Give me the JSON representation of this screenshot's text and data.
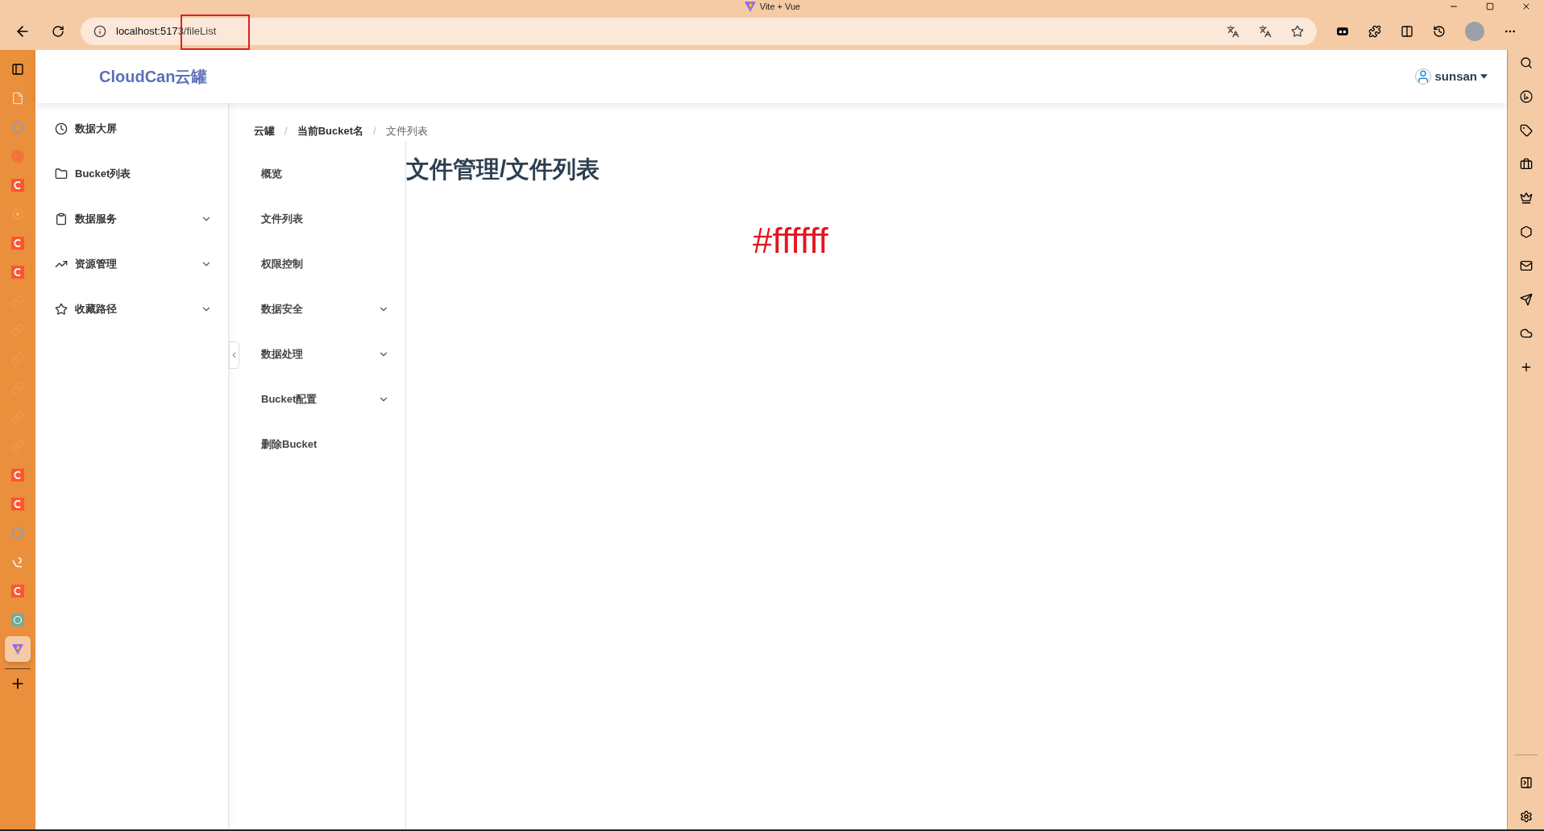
{
  "window": {
    "title": "Vite + Vue"
  },
  "address_bar": {
    "url_host": "localhost:517",
    "url_rest": "3/fileList"
  },
  "annotation": {
    "kind": "highlight"
  },
  "browser_tabs": [
    {
      "kind": "panel",
      "selected": false
    },
    {
      "kind": "page",
      "selected": false
    },
    {
      "kind": "blue",
      "selected": false
    },
    {
      "kind": "orange",
      "selected": false
    },
    {
      "kind": "c",
      "selected": false
    },
    {
      "kind": "flower",
      "selected": false
    },
    {
      "kind": "c",
      "selected": false
    },
    {
      "kind": "c",
      "selected": false
    },
    {
      "kind": "link",
      "selected": false
    },
    {
      "kind": "link",
      "selected": false
    },
    {
      "kind": "link",
      "selected": false
    },
    {
      "kind": "link",
      "selected": false
    },
    {
      "kind": "link",
      "selected": false
    },
    {
      "kind": "link",
      "selected": false
    },
    {
      "kind": "c",
      "selected": false
    },
    {
      "kind": "c",
      "selected": false
    },
    {
      "kind": "blue",
      "selected": false
    },
    {
      "kind": "swirl",
      "selected": false
    },
    {
      "kind": "c",
      "selected": false
    },
    {
      "kind": "ai",
      "selected": false
    },
    {
      "kind": "vite",
      "selected": true
    }
  ],
  "app": {
    "logo": "CloudCan云罐",
    "user": "sunsan"
  },
  "sidebar": {
    "items": [
      {
        "label": "数据大屏",
        "expandable": false
      },
      {
        "label": "Bucket列表",
        "expandable": false
      },
      {
        "label": "数据服务",
        "expandable": true
      },
      {
        "label": "资源管理",
        "expandable": true
      },
      {
        "label": "收藏路径",
        "expandable": true
      }
    ]
  },
  "breadcrumb": [
    {
      "label": "云罐",
      "current": false
    },
    {
      "label": "当前Bucket名",
      "current": false
    },
    {
      "label": "文件列表",
      "current": true
    }
  ],
  "breadcrumb_separator": "/",
  "submenu": {
    "items": [
      {
        "label": "概览",
        "expandable": false
      },
      {
        "label": "文件列表",
        "expandable": false
      },
      {
        "label": "权限控制",
        "expandable": false
      },
      {
        "label": "数据安全",
        "expandable": true
      },
      {
        "label": "数据处理",
        "expandable": true
      },
      {
        "label": "Bucket配置",
        "expandable": true
      },
      {
        "label": "删除Bucket",
        "expandable": false
      }
    ]
  },
  "content": {
    "heading": "文件管理/文件列表",
    "color_text": "#ffffff"
  }
}
